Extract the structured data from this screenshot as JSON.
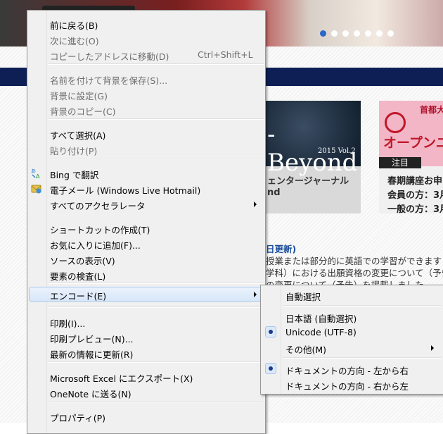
{
  "background_page": {
    "card1": {
      "title": "-Beyond",
      "vol": "2015 Vol.2",
      "caption1": "ェンタージャーナル",
      "caption2": "nd"
    },
    "card2": {
      "title_top": "首都大",
      "title_main": "オープンユ",
      "tag": "注目",
      "line1": "春期講座お申",
      "line2": "会員の方：3月",
      "line3": "一般の方：3月"
    },
    "news": {
      "line1": "日更新)",
      "line2": "授業または部分的に英語での学習ができます",
      "line3": "学科）における出願資格の変更について（予告)",
      "line4": "の変更について（予告）を掲載しました"
    }
  },
  "context_menu": {
    "groups": [
      [
        {
          "label": "前に戻る(B)",
          "accel": "",
          "enabled": true
        },
        {
          "label": "次に進む(O)",
          "accel": "",
          "enabled": false
        },
        {
          "label": "コピーしたアドレスに移動(D)",
          "accel": "Ctrl+Shift+L",
          "enabled": false
        }
      ],
      [
        {
          "label": "名前を付けて背景を保存(S)...",
          "accel": "",
          "enabled": false
        },
        {
          "label": "背景に設定(G)",
          "accel": "",
          "enabled": false
        },
        {
          "label": "背景のコピー(C)",
          "accel": "",
          "enabled": false
        }
      ],
      [
        {
          "label": "すべて選択(A)",
          "accel": "",
          "enabled": true
        },
        {
          "label": "貼り付け(P)",
          "accel": "",
          "enabled": false
        }
      ],
      [
        {
          "label": "Bing で翻訳",
          "accel": "",
          "enabled": true,
          "icon": "bing-translate-icon"
        },
        {
          "label": "電子メール (Windows Live Hotmail)",
          "accel": "",
          "enabled": true,
          "icon": "email-icon"
        },
        {
          "label": "すべてのアクセラレータ",
          "accel": "",
          "enabled": true,
          "submenu": true
        }
      ],
      [
        {
          "label": "ショートカットの作成(T)",
          "accel": "",
          "enabled": true
        },
        {
          "label": "お気に入りに追加(F)...",
          "accel": "",
          "enabled": true
        },
        {
          "label": "ソースの表示(V)",
          "accel": "",
          "enabled": true
        },
        {
          "label": "要素の検査(L)",
          "accel": "",
          "enabled": true
        }
      ],
      [
        {
          "label": "エンコード(E)",
          "accel": "",
          "enabled": true,
          "submenu": true,
          "highlighted": true
        }
      ],
      [
        {
          "label": "印刷(I)...",
          "accel": "",
          "enabled": true
        },
        {
          "label": "印刷プレビュー(N)...",
          "accel": "",
          "enabled": true
        },
        {
          "label": "最新の情報に更新(R)",
          "accel": "",
          "enabled": true
        }
      ],
      [
        {
          "label": "Microsoft Excel にエクスポート(X)",
          "accel": "",
          "enabled": true
        },
        {
          "label": "OneNote に送る(N)",
          "accel": "",
          "enabled": true
        }
      ],
      [
        {
          "label": "プロパティ(P)",
          "accel": "",
          "enabled": true
        }
      ]
    ]
  },
  "encoding_submenu": {
    "groups": [
      [
        {
          "label": "自動選択",
          "checked": false
        }
      ],
      [
        {
          "label": "日本語 (自動選択)",
          "checked": false
        },
        {
          "label": "Unicode (UTF-8)",
          "checked": true
        },
        {
          "label": "その他(M)",
          "checked": false,
          "submenu": true
        }
      ],
      [
        {
          "label": "ドキュメントの方向 - 左から右",
          "checked": true
        },
        {
          "label": "ドキュメントの方向 - 右から左",
          "checked": false
        }
      ]
    ]
  },
  "colors": {
    "highlight_border": "#a8c7ec",
    "disabled_text": "#6d6d6d",
    "navbar": "#0d1f55"
  }
}
